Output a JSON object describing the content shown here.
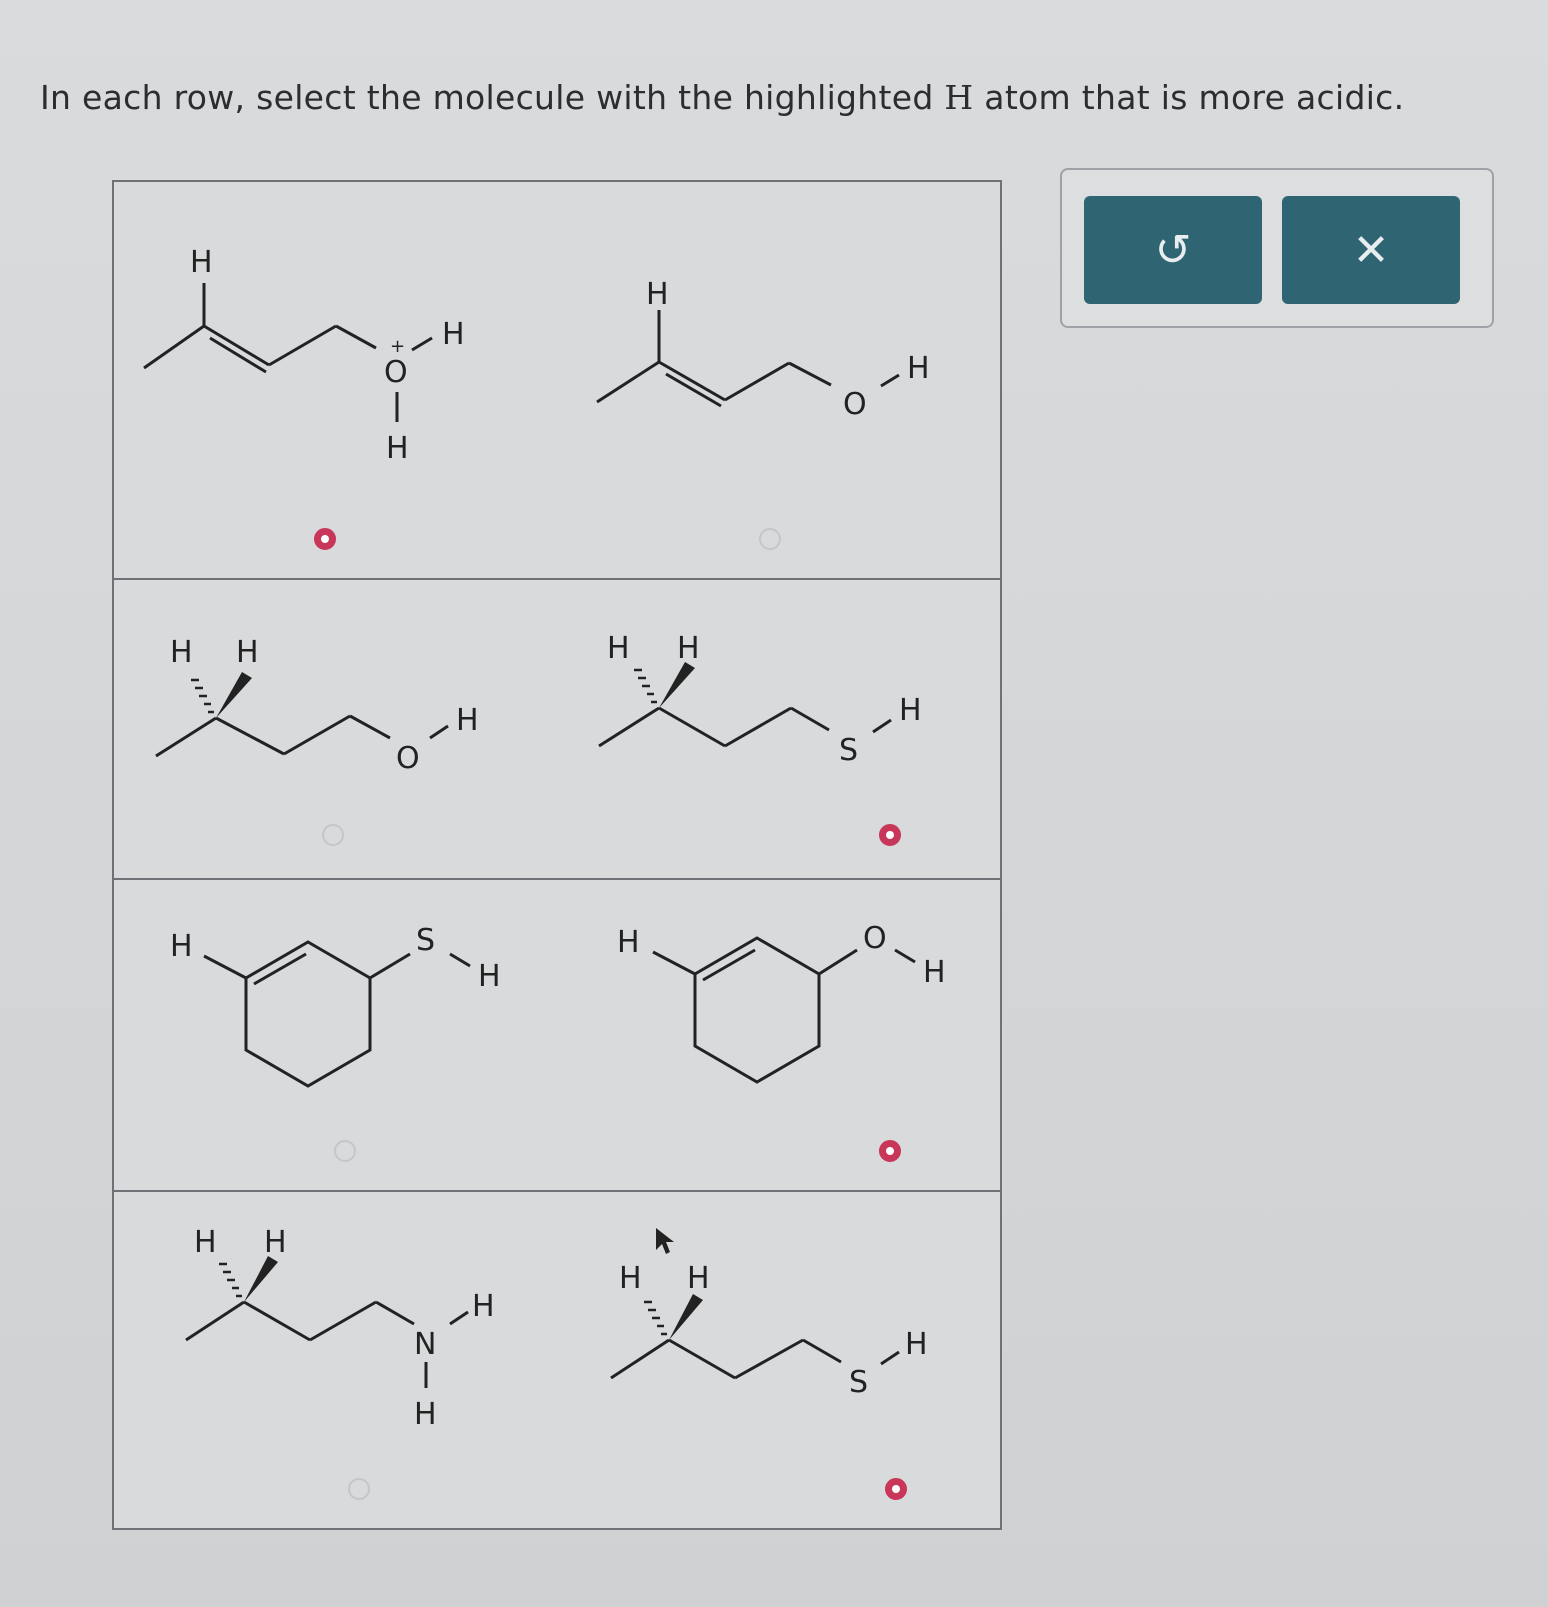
{
  "question": {
    "prefix": "In each row, select the molecule with the highlighted",
    "h_symbol": "H",
    "suffix": "atom that is more acidic."
  },
  "toolbar": {
    "undo_icon": "undo-icon",
    "undo_glyph": "↺",
    "close_icon": "close-icon",
    "close_glyph": "✕",
    "button_color": "#2f6573"
  },
  "accent_color": "#c8375a",
  "rows": [
    {
      "options": [
        {
          "molecule": "oxonium-allyl",
          "selected": true,
          "atoms": {
            "h_top": "H",
            "charge": "+",
            "o": "O",
            "h_right": "H",
            "h_bottom": "H"
          }
        },
        {
          "molecule": "allyl-alcohol",
          "selected": false,
          "atoms": {
            "h_top": "H",
            "o": "O",
            "h_right": "H"
          }
        }
      ]
    },
    {
      "options": [
        {
          "molecule": "propanol",
          "selected": false,
          "atoms": {
            "h1": "H",
            "h2": "H",
            "o": "O",
            "h_right": "H"
          }
        },
        {
          "molecule": "propanethiol",
          "selected": true,
          "atoms": {
            "h1": "H",
            "h2": "H",
            "s": "S",
            "h_right": "H"
          }
        }
      ]
    },
    {
      "options": [
        {
          "molecule": "cyclohexene-thiol",
          "selected": false,
          "atoms": {
            "h_left": "H",
            "s": "S",
            "h_right": "H"
          }
        },
        {
          "molecule": "cyclohexene-ol",
          "selected": true,
          "atoms": {
            "h_left": "H",
            "o": "O",
            "h_right": "H"
          }
        }
      ]
    },
    {
      "options": [
        {
          "molecule": "propylamine",
          "selected": false,
          "atoms": {
            "h1": "H",
            "h2": "H",
            "n": "N",
            "h_right": "H",
            "h_bottom": "H"
          }
        },
        {
          "molecule": "propanethiol",
          "selected": true,
          "atoms": {
            "h1": "H",
            "h2": "H",
            "s": "S",
            "h_right": "H"
          }
        }
      ]
    }
  ]
}
